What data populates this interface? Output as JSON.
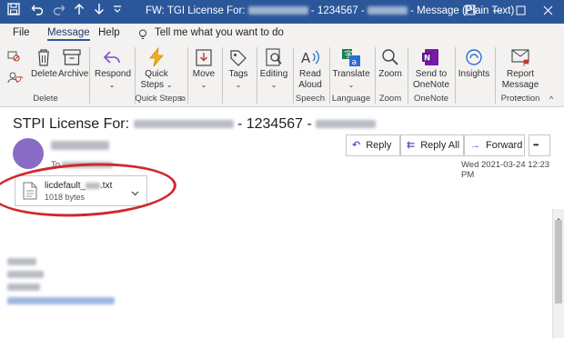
{
  "titlebar": {
    "title_prefix": "FW: TGI License For:",
    "title_number": "- 1234567 -",
    "title_suffix": "-  Message (Plain Text)",
    "bg": "#2b579a",
    "win_buttons": [
      "minimize-icon",
      "restore-icon",
      "close-icon"
    ]
  },
  "tabs": [
    {
      "label": "File"
    },
    {
      "label": "Message"
    },
    {
      "label": "Help"
    }
  ],
  "tell_me": "Tell me what you want to do",
  "ribbon": {
    "buttons": {
      "delete": "Delete",
      "archive": "Archive",
      "respond": "Respond",
      "quick_steps_1": "Quick",
      "quick_steps_2": "Steps",
      "move": "Move",
      "tags": "Tags",
      "editing": "Editing",
      "read_aloud_1": "Read",
      "read_aloud_2": "Aloud",
      "translate": "Translate",
      "zoom": "Zoom",
      "send_onenote_1": "Send to",
      "send_onenote_2": "OneNote",
      "insights": "Insights",
      "report_1": "Report",
      "report_2": "Message"
    },
    "groups": {
      "delete": "Delete",
      "quick_steps": "Quick Steps",
      "speech": "Speech",
      "language": "Language",
      "zoom": "Zoom",
      "onenote": "OneNote",
      "protection": "Protection"
    }
  },
  "message": {
    "subject_prefix": "STPI License For:",
    "subject_number": "- 1234567 -",
    "to_label": "To",
    "timestamp": "Wed 2021-03-24 12:23 PM",
    "actions": {
      "reply": "Reply",
      "reply_all": "Reply All",
      "forward": "Forward",
      "more": "•••"
    },
    "attachment": {
      "name_prefix": "licdefault_",
      "name_suffix": ".txt",
      "size": "1018 bytes"
    },
    "highlight_color": "#d0282c"
  }
}
